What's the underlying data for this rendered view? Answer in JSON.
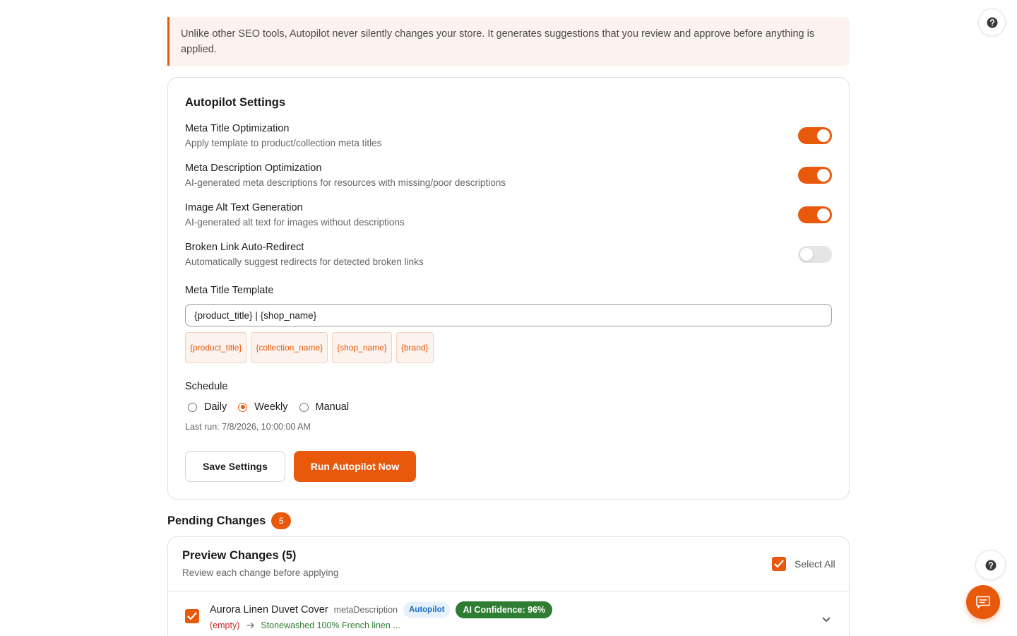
{
  "banner": {
    "text": "Unlike other SEO tools, Autopilot never silently changes your store. It generates suggestions that you review and approve before anything is applied."
  },
  "settings": {
    "title": "Autopilot Settings",
    "items": [
      {
        "name": "Meta Title Optimization",
        "description": "Apply template to product/collection meta titles",
        "enabled": true
      },
      {
        "name": "Meta Description Optimization",
        "description": "AI-generated meta descriptions for resources with missing/poor descriptions",
        "enabled": true
      },
      {
        "name": "Image Alt Text Generation",
        "description": "AI-generated alt text for images without descriptions",
        "enabled": true
      },
      {
        "name": "Broken Link Auto-Redirect",
        "description": "Automatically suggest redirects for detected broken links",
        "enabled": false
      }
    ],
    "template": {
      "label": "Meta Title Template",
      "value": "{product_title} | {shop_name}",
      "variables": [
        "{product_title}",
        "{collection_name}",
        "{shop_name}",
        "{brand}"
      ]
    },
    "schedule": {
      "label": "Schedule",
      "options": [
        "Daily",
        "Weekly",
        "Manual"
      ],
      "selected": "Weekly",
      "last_run": "Last run: 7/8/2026, 10:00:00 AM"
    },
    "buttons": {
      "save": "Save Settings",
      "run": "Run Autopilot Now"
    }
  },
  "pending": {
    "title": "Pending Changes",
    "count": "5",
    "preview_title": "Preview Changes (5)",
    "preview_subtitle": "Review each change before applying",
    "select_all": "Select All",
    "rows": [
      {
        "name": "Aurora Linen Duvet Cover",
        "field": "metaDescription",
        "source": "Autopilot",
        "confidence": "AI Confidence: 96%",
        "old_value": "(empty)",
        "new_value": "Stonewashed 100% French linen ...",
        "checked": true
      }
    ]
  },
  "colors": {
    "accent": "#e8590c",
    "success": "#2e7d32",
    "danger": "#c62828",
    "info": "#1f6fc5"
  },
  "icons": {
    "help": "help-icon",
    "chat": "chat-icon",
    "check": "check-icon",
    "chevron": "chevron-down-icon",
    "arrow": "arrow-right-icon"
  }
}
